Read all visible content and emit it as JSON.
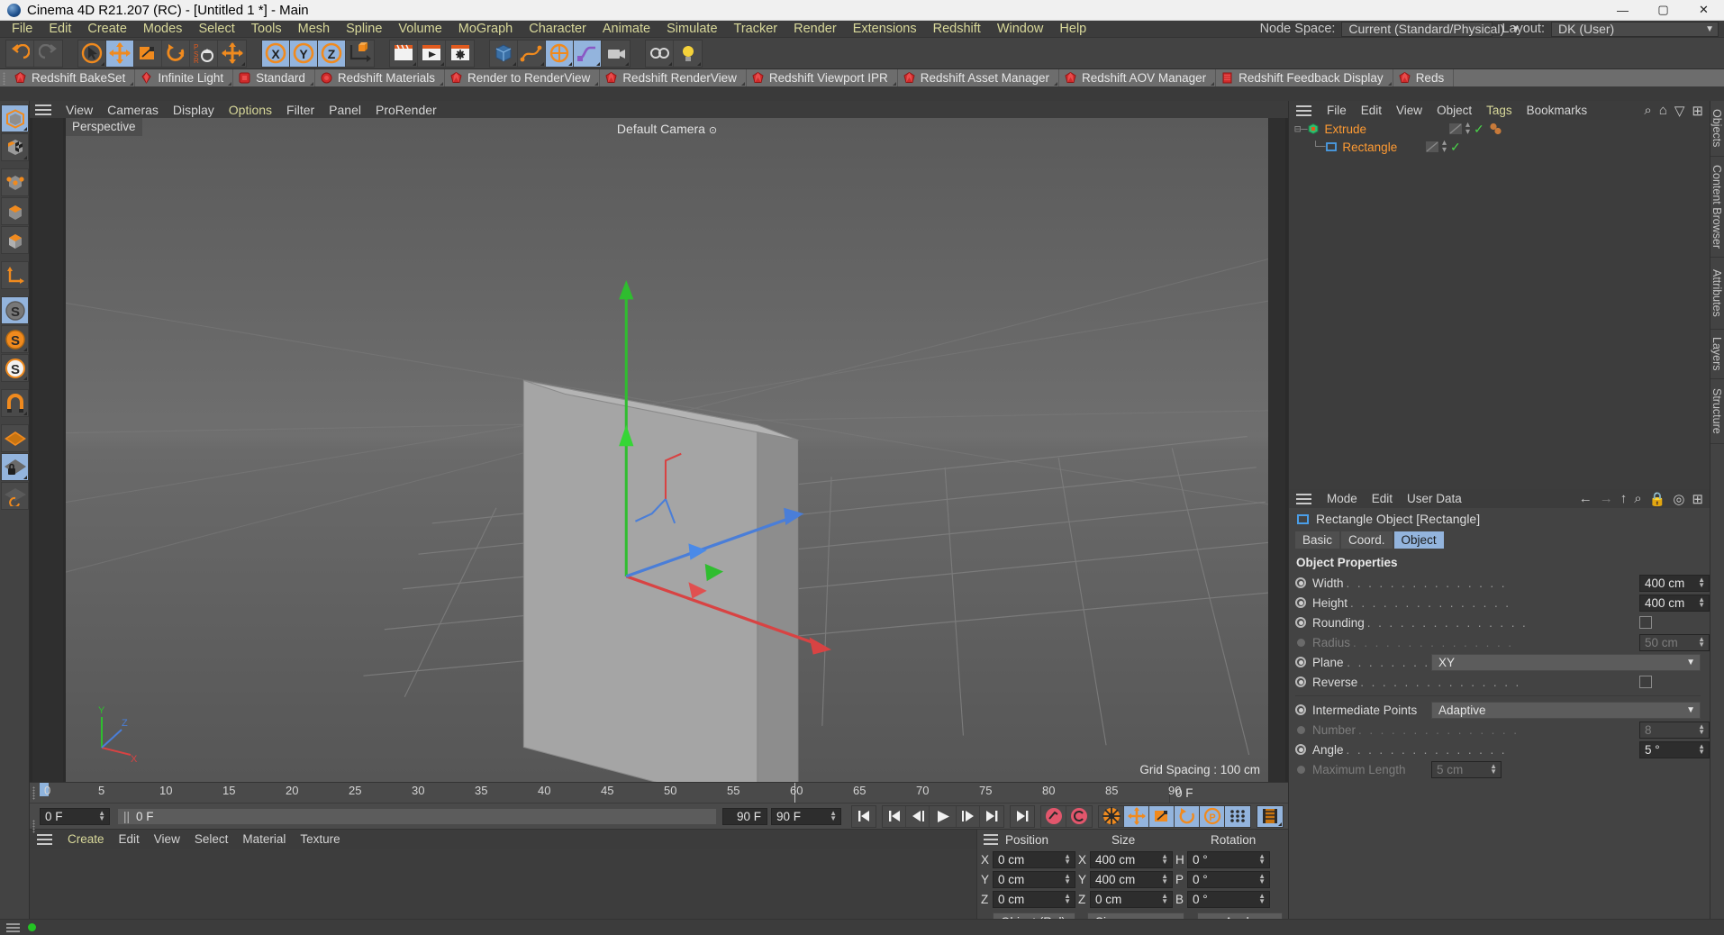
{
  "titlebar": {
    "title": "Cinema 4D R21.207 (RC) - [Untitled 1 *] - Main",
    "minimize": "—",
    "maximize": "▢",
    "close": "✕"
  },
  "menubar": {
    "items": [
      "File",
      "Edit",
      "Create",
      "Modes",
      "Select",
      "Tools",
      "Mesh",
      "Spline",
      "Volume",
      "MoGraph",
      "Character",
      "Animate",
      "Simulate",
      "Tracker",
      "Render",
      "Extensions",
      "Redshift",
      "Window",
      "Help"
    ],
    "node_space_label": "Node Space:",
    "node_space_value": "Current (Standard/Physical)",
    "layout_label": "Layout:",
    "layout_value": "DK (User)"
  },
  "redshift_tabs": [
    "Redshift BakeSet",
    "Infinite Light",
    "Standard",
    "Redshift Materials",
    "Render to RenderView",
    "Redshift RenderView",
    "Redshift Viewport IPR",
    "Redshift Asset Manager",
    "Redshift AOV Manager",
    "Redshift Feedback Display",
    "Reds"
  ],
  "viewport": {
    "menu": [
      "View",
      "Cameras",
      "Display",
      "Options",
      "Filter",
      "Panel",
      "ProRender"
    ],
    "highlight_menu": "Options",
    "label": "Perspective",
    "camera": "Default Camera",
    "grid_spacing": "Grid Spacing : 100 cm",
    "axis_x": "X",
    "axis_y": "Y",
    "axis_z": "Z"
  },
  "timeline": {
    "ticks": [
      "0",
      "5",
      "10",
      "15",
      "20",
      "25",
      "30",
      "35",
      "40",
      "45",
      "50",
      "55",
      "60",
      "65",
      "70",
      "75",
      "80",
      "85",
      "90"
    ],
    "current_frame_field": "0 F",
    "preview_range_field": "0 F",
    "end_left": "90 F",
    "end_right": "90 F",
    "right_frame_field": "0 F"
  },
  "material_manager": {
    "menu": [
      "Create",
      "Edit",
      "View",
      "Select",
      "Material",
      "Texture"
    ]
  },
  "coordinates": {
    "header": {
      "position": "Position",
      "size": "Size",
      "rotation": "Rotation"
    },
    "rows": [
      {
        "p_axis": "X",
        "p_val": "0 cm",
        "s_axis": "X",
        "s_val": "400 cm",
        "r_axis": "H",
        "r_val": "0 °"
      },
      {
        "p_axis": "Y",
        "p_val": "0 cm",
        "s_axis": "Y",
        "s_val": "400 cm",
        "r_axis": "P",
        "r_val": "0 °"
      },
      {
        "p_axis": "Z",
        "p_val": "0 cm",
        "s_axis": "Z",
        "s_val": "0 cm",
        "r_axis": "B",
        "r_val": "0 °"
      }
    ],
    "mode_select": "Object (Rel)",
    "size_select": "Size",
    "apply_button": "Apply"
  },
  "object_manager": {
    "menu": [
      "File",
      "Edit",
      "View",
      "Object",
      "Tags",
      "Bookmarks"
    ],
    "highlight_menu": "Tags",
    "items": [
      {
        "name": "Extrude",
        "indent": 0,
        "selected": true
      },
      {
        "name": "Rectangle",
        "indent": 1,
        "selected": true
      }
    ]
  },
  "attributes": {
    "menu": [
      "Mode",
      "Edit",
      "User Data"
    ],
    "object_title": "Rectangle Object [Rectangle]",
    "tabs": [
      "Basic",
      "Coord.",
      "Object"
    ],
    "active_tab": "Object",
    "section_title": "Object Properties",
    "properties": [
      {
        "label": "Width",
        "type": "number",
        "value": "400 cm",
        "enabled": true
      },
      {
        "label": "Height",
        "type": "number",
        "value": "400 cm",
        "enabled": true
      },
      {
        "label": "Rounding",
        "type": "checkbox",
        "value": "",
        "enabled": true,
        "checked": false
      },
      {
        "label": "Radius",
        "type": "number",
        "value": "50 cm",
        "enabled": false
      },
      {
        "label": "Plane",
        "type": "select",
        "value": "XY",
        "enabled": true
      },
      {
        "label": "Reverse",
        "type": "checkbox",
        "value": "",
        "enabled": true,
        "checked": false
      },
      {
        "label": "Intermediate Points",
        "type": "select",
        "value": "Adaptive",
        "enabled": true
      },
      {
        "label": "Number",
        "type": "number",
        "value": "8",
        "enabled": false
      },
      {
        "label": "Angle",
        "type": "number",
        "value": "5 °",
        "enabled": true
      },
      {
        "label": "Maximum Length",
        "type": "number",
        "value": "5 cm",
        "enabled": false
      }
    ]
  },
  "right_vertical_tabs": [
    "Objects",
    "Content Browser",
    "Attributes",
    "Layers",
    "Structure"
  ],
  "colors": {
    "accent_orange": "#ff9b33",
    "select_blue": "#93b4dd",
    "menu_yellow": "#d8d89a",
    "redshift_red": "#e03c3c",
    "axis_x": "#d64b4b",
    "axis_y": "#4bd64b",
    "axis_z": "#4b7bd6",
    "status_green": "#23c423"
  }
}
